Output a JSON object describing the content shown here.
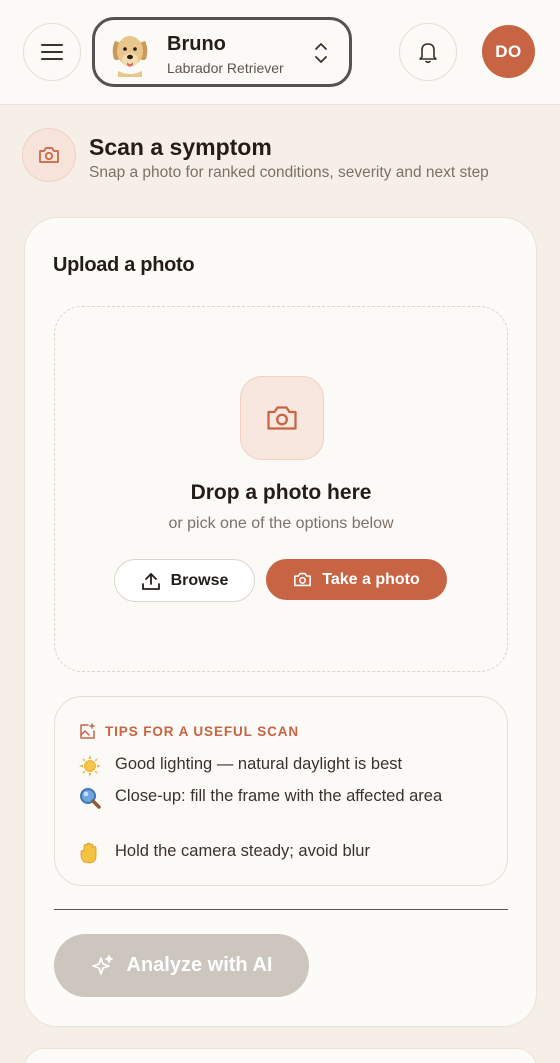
{
  "header": {
    "pet": {
      "name": "Bruno",
      "breed": "Labrador Retriever"
    },
    "avatar_initials": "DO"
  },
  "scan": {
    "title": "Scan a symptom",
    "subtitle": "Snap a photo for ranked conditions, severity and next step"
  },
  "upload": {
    "card_title": "Upload a photo",
    "drop_title": "Drop a photo here",
    "drop_subtitle": "or pick one of the options below",
    "browse_label": "Browse",
    "take_photo_label": "Take a photo"
  },
  "tips": {
    "heading": "TIPS FOR A USEFUL SCAN",
    "items": [
      {
        "icon": "sun-icon",
        "text": "Good lighting — natural daylight is best"
      },
      {
        "icon": "magnifier-icon",
        "text": "Close-up: fill the frame with the affected area"
      },
      {
        "icon": "hand-icon",
        "text": "Hold the camera steady; avoid blur"
      }
    ]
  },
  "analyze_label": "Analyze with AI",
  "colors": {
    "accent": "#c66443",
    "background": "#f5efe8",
    "card": "#fdfbf8",
    "disabled_button": "#cdc6bf"
  }
}
